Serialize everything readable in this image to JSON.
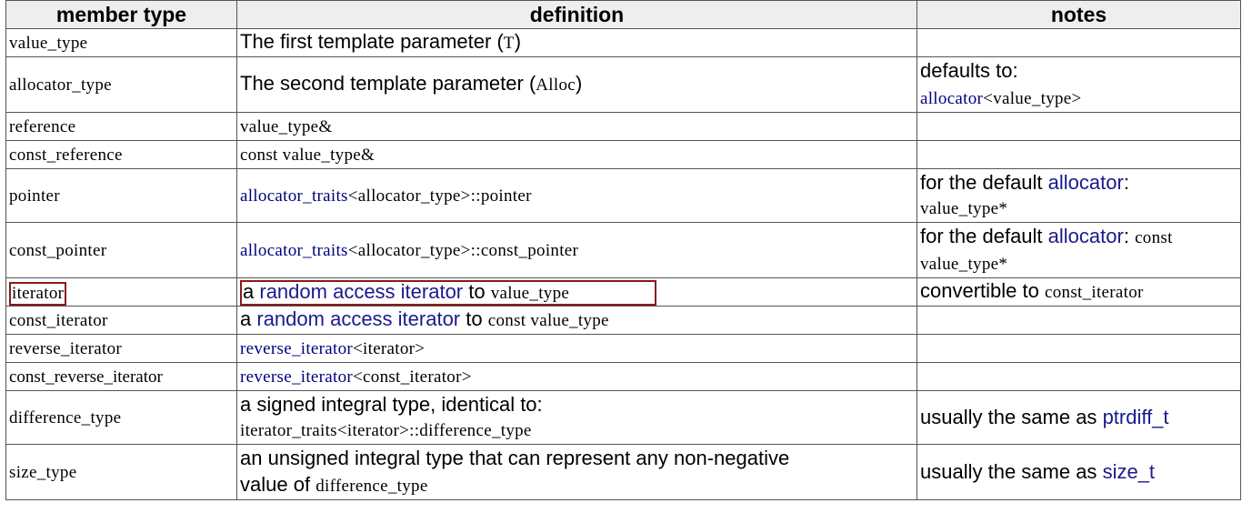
{
  "headers": {
    "member_type": "member type",
    "definition": "definition",
    "notes": "notes"
  },
  "rows": {
    "r0": {
      "member": "value_type",
      "def_text": "The first template parameter (",
      "def_code": "T",
      "def_end": ")"
    },
    "r1": {
      "member": "allocator_type",
      "def_text": "The second template parameter (",
      "def_code": "Alloc",
      "def_end": ")",
      "notes_text": "defaults to:",
      "notes_link": "allocator",
      "notes_code": "<value_type>"
    },
    "r2": {
      "member": "reference",
      "def_code": "value_type&"
    },
    "r3": {
      "member": "const_reference",
      "def_code": "const value_type&"
    },
    "r4": {
      "member": "pointer",
      "def_link": "allocator_traits",
      "def_code": "<allocator_type>::pointer",
      "notes_text": "for the default",
      "notes_link": "allocator",
      "notes_colon": ":",
      "notes_code": "value_type*"
    },
    "r5": {
      "member": "const_pointer",
      "def_link": "allocator_traits",
      "def_code": "<allocator_type>::const_pointer",
      "notes_text": "for the default",
      "notes_link": "allocator",
      "notes_colon": ":",
      "notes_code1": "const",
      "notes_code2": "value_type*"
    },
    "r6": {
      "member": "iterator",
      "def_a": "a",
      "def_link": "random access iterator",
      "def_to": "to",
      "def_code": "value_type",
      "notes_text": "convertible to",
      "notes_code": "const_iterator"
    },
    "r7": {
      "member": "const_iterator",
      "def_a": "a",
      "def_link": "random access iterator",
      "def_to": "to",
      "def_code": "const value_type"
    },
    "r8": {
      "member": "reverse_iterator",
      "def_link": "reverse_iterator",
      "def_code": "<iterator>"
    },
    "r9": {
      "member": "const_reverse_iterator",
      "def_link": "reverse_iterator",
      "def_code": "<const_iterator>"
    },
    "r10": {
      "member": "difference_type",
      "def_text": "a signed integral type, identical to:",
      "def_code": "iterator_traits<iterator>::difference_type",
      "notes_text": "usually the same as",
      "notes_link": "ptrdiff_t"
    },
    "r11": {
      "member": "size_type",
      "def_text": "an unsigned integral type that can represent any non-negative",
      "def_text2": "value of",
      "def_code": "difference_type",
      "notes_text": "usually the same as",
      "notes_link": "size_t"
    }
  },
  "colors": {
    "link": "#000080",
    "highlight_border": "#8b1a1a",
    "header_bg": "#eeeeee"
  }
}
